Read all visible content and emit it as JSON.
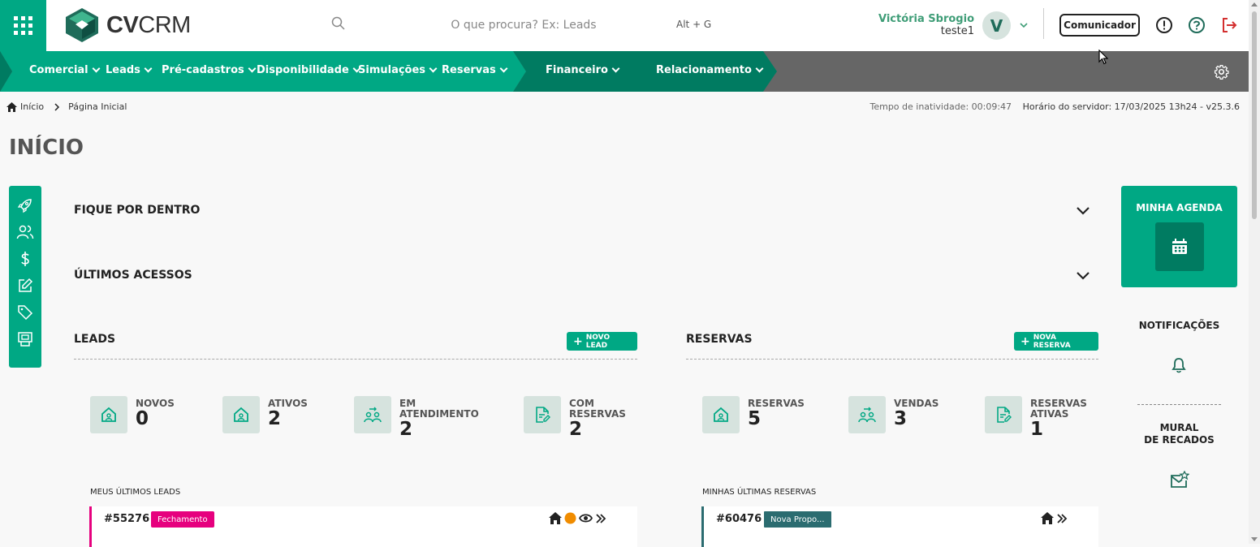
{
  "header": {
    "brand_bold": "CV",
    "brand_light": "CRM",
    "search_placeholder": "O que procura? Ex: Leads",
    "shortcut": "Alt + G",
    "user_name": "Victória Sbrogio",
    "user_role": "teste1",
    "avatar_initial": "V",
    "communicator_label": "Comunicador"
  },
  "nav": {
    "items": [
      {
        "label": "Comercial"
      },
      {
        "label": "Leads"
      },
      {
        "label": "Pré-cadastros"
      },
      {
        "label": "Disponibilidade"
      },
      {
        "label": "Simulações"
      },
      {
        "label": "Reservas"
      },
      {
        "label": "Financeiro"
      },
      {
        "label": "Relacionamento"
      }
    ]
  },
  "breadcrumb": {
    "home": "Início",
    "current": "Página Inicial"
  },
  "server": {
    "inactivity": "Tempo de inatividade: 00:09:47",
    "server_time": "Horário do servidor: 17/03/2025 13h24 - v25.3.6"
  },
  "page_title": "INÍCIO",
  "accordions": {
    "fique_por_dentro": "FIQUE POR DENTRO",
    "ultimos_acessos": "ÚLTIMOS ACESSOS"
  },
  "leads": {
    "title": "LEADS",
    "add_label": "NOVO LEAD",
    "stats": [
      {
        "label": "NOVOS",
        "value": "0"
      },
      {
        "label": "ATIVOS",
        "value": "2"
      },
      {
        "label": "EM ATENDIMENTO",
        "value": "2"
      },
      {
        "label": "COM RESERVAS",
        "value": "2"
      }
    ],
    "list_title": "MEUS ÚLTIMOS LEADS",
    "latest": {
      "id": "#55276",
      "status": "Fechamento"
    }
  },
  "reservas": {
    "title": "RESERVAS",
    "add_label": "NOVA RESERVA",
    "stats": [
      {
        "label": "RESERVAS",
        "value": "5"
      },
      {
        "label": "VENDAS",
        "value": "3"
      },
      {
        "label": "RESERVAS ATIVAS",
        "value": "1"
      }
    ],
    "list_title": "MINHAS ÚLTIMAS RESERVAS",
    "latest": {
      "id": "#60476",
      "status": "Nova Propo..."
    }
  },
  "right": {
    "agenda": "MINHA AGENDA",
    "notifications": "NOTIFICAÇÕES",
    "mural": "MURAL\nDE RECADOS"
  },
  "colors": {
    "brand": "#00a884",
    "brand_dark": "#007b61",
    "nav_gray": "#666666",
    "lead_badge": "#e6007e",
    "reserva_badge": "#2b6c70",
    "logout": "#d32f2f"
  }
}
